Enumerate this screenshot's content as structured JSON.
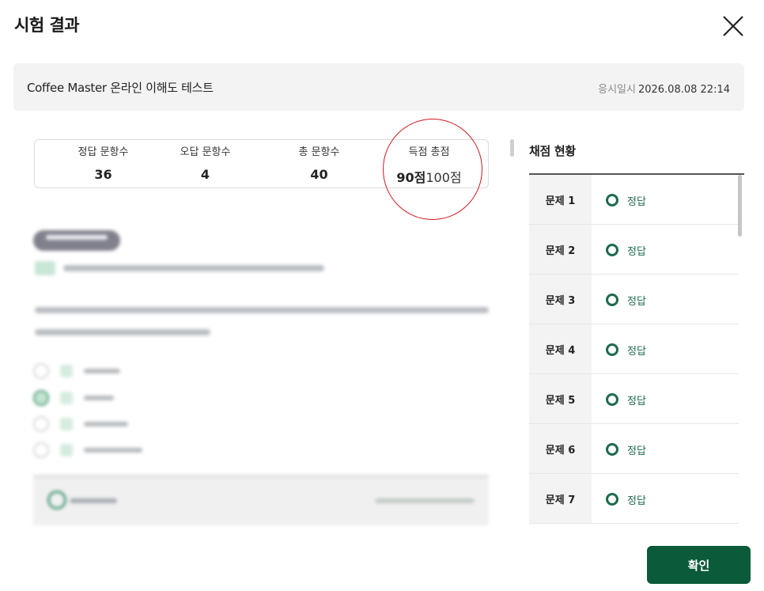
{
  "header": {
    "title": "시험 결과",
    "close_icon": "close-icon"
  },
  "exam_info": {
    "name": "Coffee Master 온라인 이해도 테스트",
    "date_label": "응시일시",
    "date_value": "2026.08.08 22:14"
  },
  "score": {
    "correct_label": "정답 문항수",
    "correct_value": "36",
    "wrong_label": "오답 문항수",
    "wrong_value": "4",
    "total_label": "총 문항수",
    "total_value": "40",
    "points_label": "득점 총점",
    "points_value": "90점",
    "points_total": "100점"
  },
  "grading": {
    "title": "채점 현황",
    "rows": [
      {
        "question": "문제 1",
        "result": "정답"
      },
      {
        "question": "문제 2",
        "result": "정답"
      },
      {
        "question": "문제 3",
        "result": "정답"
      },
      {
        "question": "문제 4",
        "result": "정답"
      },
      {
        "question": "문제 5",
        "result": "정답"
      },
      {
        "question": "문제 6",
        "result": "정답"
      },
      {
        "question": "문제 7",
        "result": "정답"
      }
    ]
  },
  "footer": {
    "confirm_label": "확인"
  },
  "colors": {
    "brand_green": "#0b5a3a",
    "correct_green": "#1d6b4c",
    "highlight_red": "#d0191d"
  }
}
